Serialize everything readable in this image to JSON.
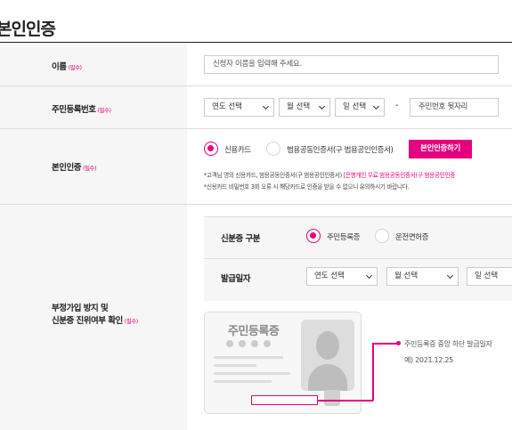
{
  "page": {
    "title": "본인인증"
  },
  "name_row": {
    "label": "이름",
    "required": "(필수)",
    "placeholder": "신청자 이름을 입력해 주세요."
  },
  "rrn_row": {
    "label": "주민등록번호",
    "required": "(필수)",
    "year": "연도 선택",
    "month": "월 선택",
    "day": "일 선택",
    "dash": "-",
    "back_placeholder": "주민번호 뒷자리"
  },
  "auth_row": {
    "label": "본인인증",
    "required": "(필수)",
    "opt_credit": "신용카드",
    "opt_cert": "범용공동인증서(구 범용공인인증서)",
    "btn": "본인인증하기",
    "note1_a": "*고객님 명의 신용카드, 범용공동인증서(구 범용공인인증서) ",
    "note1_b": "[은행개인 무료 범용공동인증서(구 범용공인인증",
    "note2": "*신용카드 비밀번호 3회 오류 시 해당카드로 인증을 받을 수 없으니 유의하시기 바랍니다."
  },
  "verify_row": {
    "label_line1": "부정가입 방지 및",
    "label_line2": "신분증 진위여부 확인",
    "required": "(필수)",
    "id_type_label": "신분증 구분",
    "opt_rrc": "주민등록증",
    "opt_license": "운전면허증",
    "issue_label": "발급일자",
    "year": "연도 선택",
    "month": "월 선택",
    "day": "일 선택",
    "card_title": "주민등록증",
    "annotation": "주민등록증 중앙 하단 발급일자",
    "example": "예) 2021.12.25"
  },
  "colors": {
    "accent": "#e5007e"
  }
}
